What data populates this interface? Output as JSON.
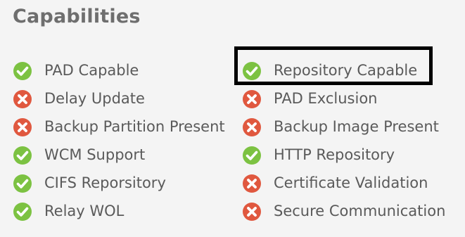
{
  "title": "Capabilities",
  "colors": {
    "check": "#7cc242",
    "cross": "#e0583f"
  },
  "left_column": [
    {
      "label": "PAD Capable",
      "status": "enabled",
      "icon": "check-icon"
    },
    {
      "label": "Delay Update",
      "status": "disabled",
      "icon": "cross-icon"
    },
    {
      "label": "Backup Partition Present",
      "status": "disabled",
      "icon": "cross-icon"
    },
    {
      "label": "WCM Support",
      "status": "enabled",
      "icon": "check-icon"
    },
    {
      "label": "CIFS Reporsitory",
      "status": "enabled",
      "icon": "check-icon"
    },
    {
      "label": "Relay WOL",
      "status": "enabled",
      "icon": "check-icon"
    }
  ],
  "right_column": [
    {
      "label": "Repository Capable",
      "status": "enabled",
      "icon": "check-icon"
    },
    {
      "label": "PAD Exclusion",
      "status": "disabled",
      "icon": "cross-icon"
    },
    {
      "label": "Backup Image Present",
      "status": "disabled",
      "icon": "cross-icon"
    },
    {
      "label": "HTTP Repository",
      "status": "enabled",
      "icon": "check-icon"
    },
    {
      "label": "Certificate Validation",
      "status": "disabled",
      "icon": "cross-icon"
    },
    {
      "label": "Secure Communication",
      "status": "disabled",
      "icon": "cross-icon"
    }
  ]
}
